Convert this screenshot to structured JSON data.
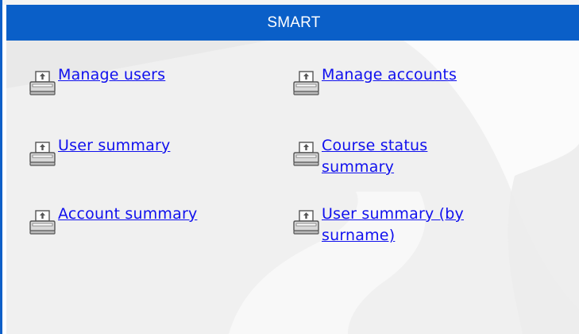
{
  "panel": {
    "title": "SMART",
    "colors": {
      "header_background": "#0a5fc8",
      "header_text": "#ffffff",
      "link": "#1010ee",
      "body_background": "#f0f0f0"
    }
  },
  "links": [
    {
      "label": "Manage users",
      "icon": "printer-icon"
    },
    {
      "label": "Manage accounts",
      "icon": "printer-icon"
    },
    {
      "label": "User summary",
      "icon": "printer-icon"
    },
    {
      "label": "Course status summary",
      "icon": "printer-icon"
    },
    {
      "label": "Account summary",
      "icon": "printer-icon"
    },
    {
      "label": "User summary (by surname)",
      "icon": "printer-icon"
    }
  ]
}
